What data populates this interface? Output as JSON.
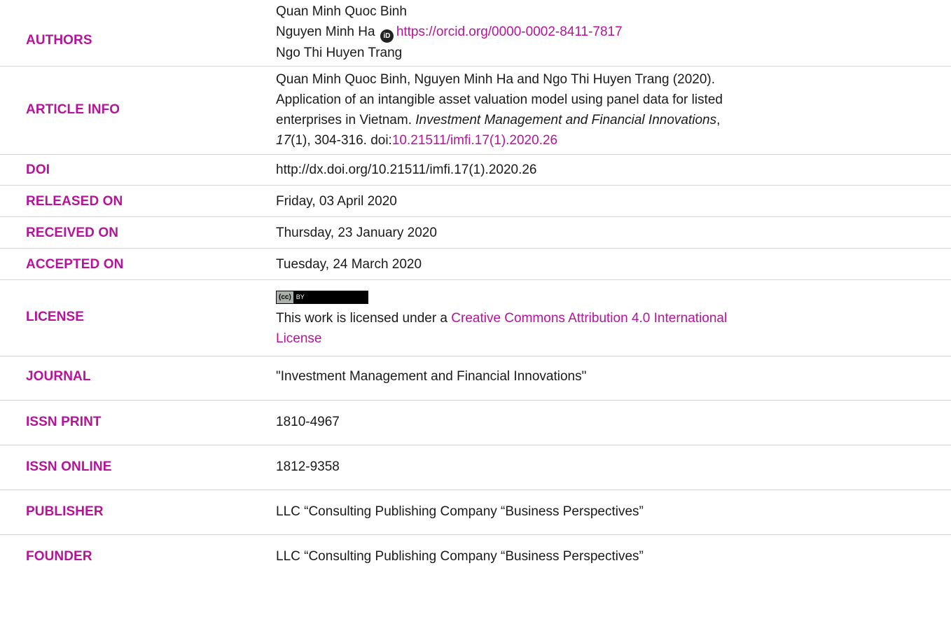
{
  "rows": {
    "authors": {
      "label": "AUTHORS",
      "author1": "Quan Minh Quoc Binh",
      "author2": "Nguyen Minh Ha",
      "orcid_icon": "orcid-icon",
      "orcid_url": "https://orcid.org/0000-0002-8411-7817",
      "author3": "Ngo Thi Huyen Trang"
    },
    "article_info": {
      "label": "ARTICLE INFO",
      "line1": "Quan Minh Quoc Binh, Nguyen Minh Ha and Ngo Thi Huyen Trang (2020).",
      "line2": "Application of an intangible asset valuation model using panel data for listed",
      "line3_prefix": "enterprises in Vietnam. ",
      "journal_italic": "Investment Management and Financial Innovations",
      "line3_suffix": ",",
      "volume_italic": "17",
      "line4_pages": "(1), 304-316. doi:",
      "doi_link": "10.21511/imfi.17(1).2020.26"
    },
    "doi": {
      "label": "DOI",
      "value": "http://dx.doi.org/10.21511/imfi.17(1).2020.26"
    },
    "released_on": {
      "label": "RELEASED ON",
      "value": "Friday, 03 April 2020"
    },
    "received_on": {
      "label": "RECEIVED ON",
      "value": "Thursday, 23 January 2020"
    },
    "accepted_on": {
      "label": "ACCEPTED ON",
      "value": "Tuesday, 24 March 2020"
    },
    "license": {
      "label": "LICENSE",
      "badge_left": "(cc)",
      "badge_right": "BY",
      "text_prefix": "This work is licensed under a ",
      "link_line1": "Creative Commons Attribution 4.0 International",
      "link_line2": "License"
    },
    "journal": {
      "label": "JOURNAL",
      "value": "\"Investment Management and Financial Innovations\""
    },
    "issn_print": {
      "label": "ISSN PRINT",
      "value": "1810-4967"
    },
    "issn_online": {
      "label": "ISSN ONLINE",
      "value": "1812-9358"
    },
    "publisher": {
      "label": "PUBLISHER",
      "value": "LLC “Consulting Publishing Company “Business Perspectives”"
    },
    "founder": {
      "label": "FOUNDER",
      "value": "LLC “Consulting Publishing Company “Business Perspectives”"
    }
  },
  "colors": {
    "label": "#b5149a",
    "text": "#1a1a1a",
    "divider": "#d4d4d4"
  }
}
